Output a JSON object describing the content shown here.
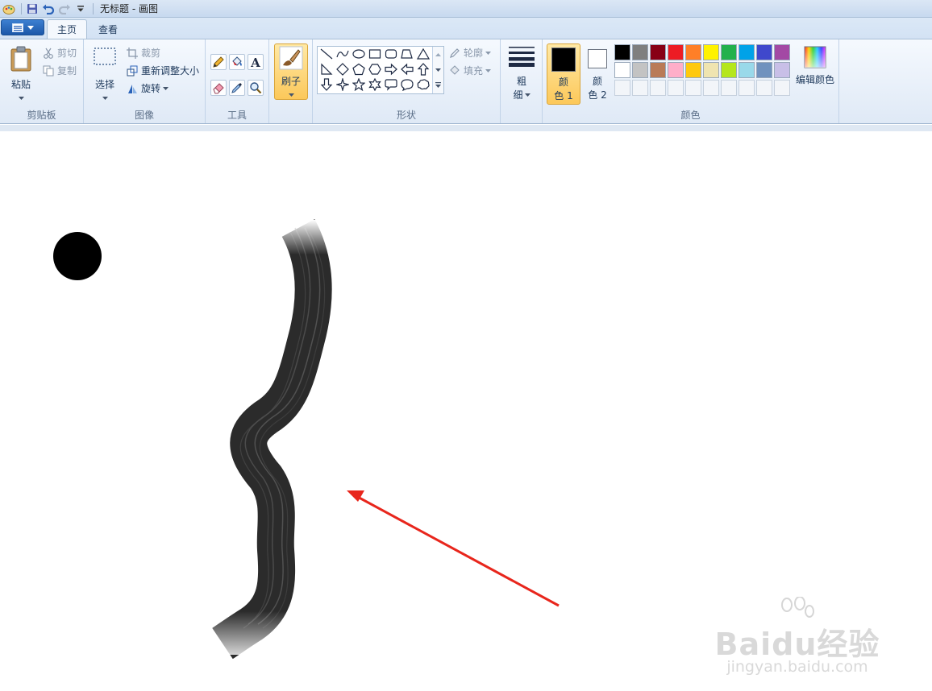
{
  "window": {
    "title": "无标题 - 画图"
  },
  "tabs": {
    "home": "主页",
    "view": "查看"
  },
  "clipboard": {
    "paste": "粘贴",
    "cut": "剪切",
    "copy": "复制",
    "group": "剪贴板"
  },
  "image": {
    "select": "选择",
    "crop": "裁剪",
    "resize": "重新调整大小",
    "rotate": "旋转",
    "group": "图像"
  },
  "tools": {
    "group": "工具"
  },
  "brush": {
    "label": "刷子"
  },
  "shapes": {
    "outline": "轮廓",
    "fill": "填充",
    "group": "形状"
  },
  "size": {
    "line1": "粗",
    "line2": "细"
  },
  "colors": {
    "color1_line1": "颜",
    "color1_line2": "色 1",
    "color2_line1": "颜",
    "color2_line2": "色 2",
    "edit": "编辑颜色",
    "group": "颜色",
    "row1": [
      "#000000",
      "#7f7f7f",
      "#880015",
      "#ed1c24",
      "#ff7f27",
      "#fff200",
      "#22b14c",
      "#00a2e8",
      "#3f48cc",
      "#a349a4"
    ],
    "row2": [
      "#ffffff",
      "#c3c3c3",
      "#b97a57",
      "#ffaec9",
      "#ffc90e",
      "#efe4b0",
      "#b5e61d",
      "#99d9ea",
      "#7092be",
      "#c8bfe7"
    ],
    "color1_value": "#000000",
    "color2_value": "#ffffff"
  },
  "watermark": {
    "brand": "Baidu经验",
    "url": "jingyan.baidu.com"
  }
}
